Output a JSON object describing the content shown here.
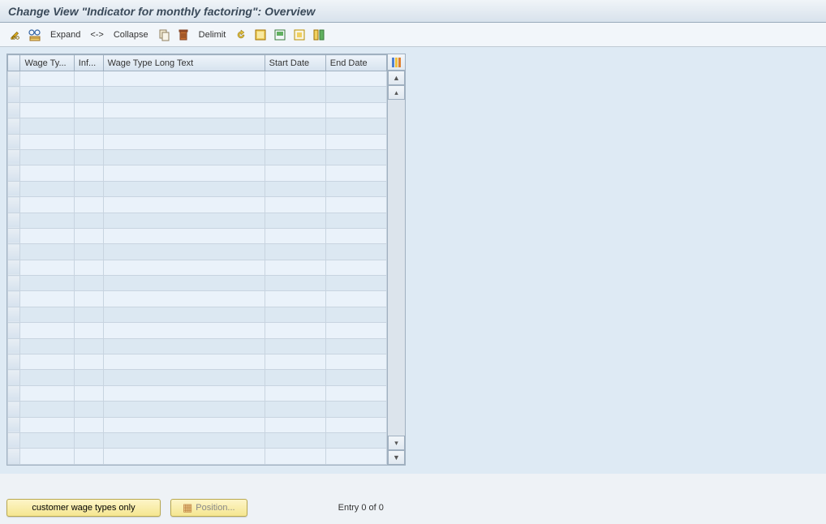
{
  "title": "Change View \"Indicator for monthly factoring\": Overview",
  "toolbar": {
    "expand_label": "Expand",
    "collapse_separator": "<->",
    "collapse_label": "Collapse",
    "delimit_label": "Delimit"
  },
  "columns": {
    "wage_type": "Wage Ty...",
    "inf": "Inf...",
    "long_text": "Wage Type Long Text",
    "start_date": "Start Date",
    "end_date": "End Date"
  },
  "footer": {
    "customer_wage_types": "customer wage types only",
    "position": "Position...",
    "entry_status": "Entry 0 of 0"
  },
  "row_count": 25
}
